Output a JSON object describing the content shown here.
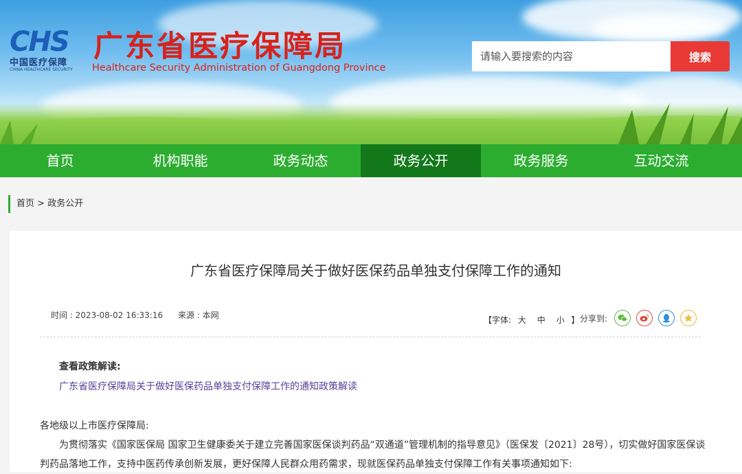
{
  "header": {
    "logo_text": "CHS",
    "logo_cn": "中国医疗保障",
    "logo_en": "CHINA HEALTHCARE SECURITY",
    "title": "广东省医疗保障局",
    "subtitle": "Healthcare Security Administration of Guangdong Province",
    "search_placeholder": "请输入要搜索的内容",
    "search_button": "搜索"
  },
  "nav": {
    "items": [
      {
        "label": "首页"
      },
      {
        "label": "机构职能"
      },
      {
        "label": "政务动态"
      },
      {
        "label": "政务公开"
      },
      {
        "label": "政务服务"
      },
      {
        "label": "互动交流"
      }
    ],
    "active_index": 3
  },
  "breadcrumb": {
    "home": "首页",
    "sep": ">",
    "current": "政务公开"
  },
  "article": {
    "title": "广东省医疗保障局关于做好医保药品单独支付保障工作的通知",
    "time": "时间 : 2023-08-02 16:33:16",
    "source": "来源 : 本网",
    "fontsize_open": "【字体:",
    "fontsize_large": "大",
    "fontsize_medium": "中",
    "fontsize_small": "小",
    "fontsize_close": "】",
    "share_label": "分享到:",
    "interp_heading": "查看政策解读:",
    "interp_link": "广东省医疗保障局关于做好医保药品单独支付保障工作的通知政策解读",
    "salutation": "各地级以上市医疗保障局:",
    "para1": "为贯彻落实《国家医保局 国家卫生健康委关于建立完善国家医保谈判药品“双通道”管理机制的指导意见》（医保发〔2021〕28号），切实做好国家医保谈判药品落地工作，支持中医药传承创新发展，更好保障人民群众用药需求，现就医保药品单独支付保障工作有关事项通知如下:"
  },
  "colors": {
    "nav_green": "#2cad30",
    "nav_active": "#12781a",
    "title_red": "#d7221b",
    "search_red": "#e93a36",
    "link_purple": "#5a3e9a"
  },
  "icons": [
    "wechat-icon",
    "weibo-icon",
    "qq-icon",
    "qzone-icon"
  ]
}
